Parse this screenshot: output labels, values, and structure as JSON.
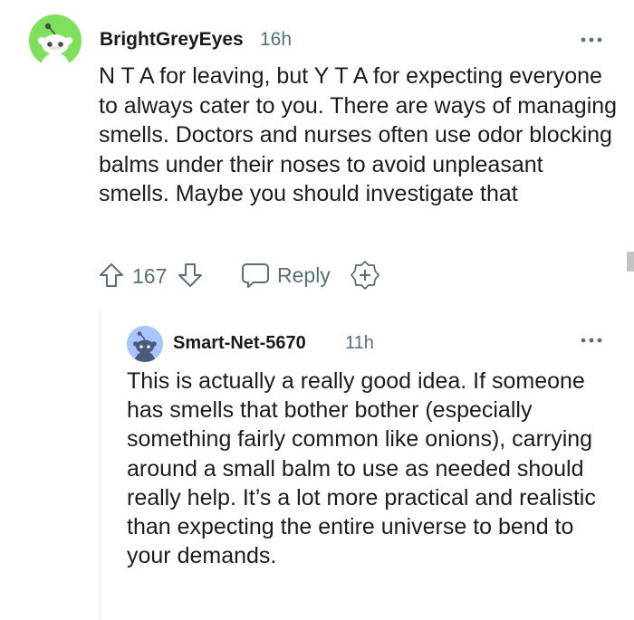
{
  "comment": {
    "username": "BrightGreyEyes",
    "time": "16h",
    "body": "N T A for leaving, but Y T A for expecting everyone to always cater to you. There are ways of managing smells. Doctors and nurses often use odor blocking balms under their noses to avoid unpleasant smells. Maybe you should investigate that",
    "score": "167",
    "reply_label": "Reply",
    "avatar_color": "#7ee05c"
  },
  "reply": {
    "username": "Smart-Net-5670",
    "time": "11h",
    "body": "This is actually a really good idea. If someone has smells that bother bother (especially something fairly common like onions), carrying around a small balm to use as needed should really help. It’s a lot more practical and realistic than expecting the entire universe to bend to your demands.",
    "avatar_color": "#a9c4ff"
  },
  "icons": {
    "more": "more-options-icon",
    "upvote": "upvote-arrow-icon",
    "downvote": "downvote-arrow-icon",
    "reply": "speech-bubble-icon",
    "award": "add-award-icon",
    "avatar": "reddit-snoo-icon"
  },
  "colors": {
    "meta_text": "#576f76",
    "body_text": "#1c1c1c"
  }
}
